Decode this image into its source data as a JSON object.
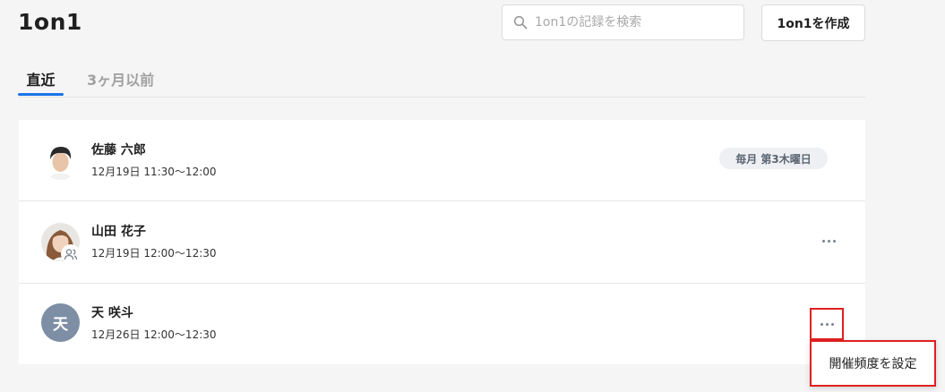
{
  "page": {
    "title": "1on1"
  },
  "search": {
    "placeholder": "1on1の記録を検索",
    "value": ""
  },
  "create_button": {
    "label": "1on1を作成"
  },
  "tabs": [
    {
      "label": "直近",
      "active": true
    },
    {
      "label": "3ヶ月以前",
      "active": false
    }
  ],
  "meetings": [
    {
      "name": "佐藤 六郎",
      "datetime": "12月19日 11:30〜12:00",
      "frequency": "毎月 第3木曜日",
      "avatar": "photo-man"
    },
    {
      "name": "山田 花子",
      "datetime": "12月19日 12:00〜12:30",
      "avatar": "photo-woman",
      "badge_icon": "group-icon",
      "more_icon": "more-horizontal-icon"
    },
    {
      "name": "天 咲斗",
      "datetime": "12月26日 12:00〜12:30",
      "avatar_letter": "天",
      "more_icon": "more-horizontal-icon"
    }
  ],
  "dropdown": {
    "items": [
      {
        "label": "開催頻度を設定"
      }
    ]
  },
  "colors": {
    "accent": "#1a73e8",
    "highlight": "#e02020",
    "avatar_letter_bg": "#7d8ea5",
    "badge_bg": "#eef0f3"
  }
}
